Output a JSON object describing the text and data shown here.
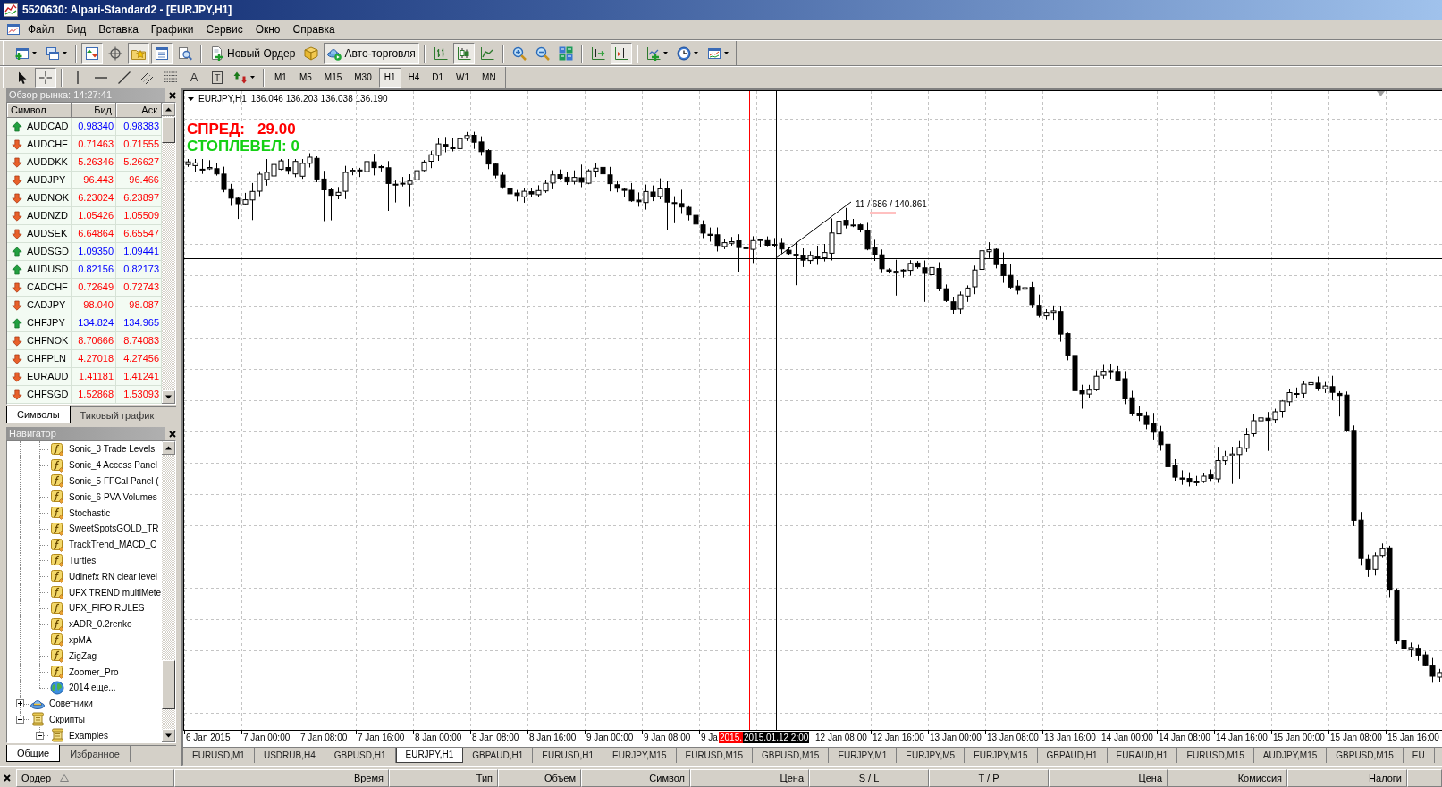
{
  "window": {
    "title": "5520630: Alpari-Standard2 - [EURJPY,H1]"
  },
  "menu": [
    "Файл",
    "Вид",
    "Вставка",
    "Графики",
    "Сервис",
    "Окно",
    "Справка"
  ],
  "toolbar": {
    "groups": [
      {
        "items": [
          {
            "kind": "new-chart",
            "pressed": false,
            "dropdown": true
          },
          {
            "kind": "profiles",
            "pressed": false,
            "dropdown": true
          }
        ]
      },
      {
        "items": [
          {
            "kind": "market-watch",
            "pressed": true,
            "dropdown": false
          },
          {
            "kind": "data-window",
            "pressed": false,
            "dropdown": false
          },
          {
            "kind": "navigator",
            "pressed": true,
            "dropdown": false
          },
          {
            "kind": "terminal",
            "pressed": true,
            "dropdown": false
          },
          {
            "kind": "tester",
            "pressed": false,
            "dropdown": false
          }
        ]
      },
      {
        "items": [
          {
            "kind": "new-order",
            "label": "Новый Ордер",
            "pressed": false,
            "dropdown": false
          },
          {
            "kind": "editor",
            "pressed": false,
            "dropdown": false
          },
          {
            "kind": "auto-trading",
            "label": "Авто-торговля",
            "pressed": true,
            "dropdown": false
          }
        ]
      },
      {
        "items": [
          {
            "kind": "bar-chart",
            "pressed": false,
            "dropdown": false
          },
          {
            "kind": "candle-chart",
            "pressed": true,
            "dropdown": false
          },
          {
            "kind": "line-chart",
            "pressed": false,
            "dropdown": false
          }
        ]
      },
      {
        "items": [
          {
            "kind": "zoom-in",
            "pressed": false,
            "dropdown": false
          },
          {
            "kind": "zoom-out",
            "pressed": false,
            "dropdown": false
          },
          {
            "kind": "tile",
            "pressed": false,
            "dropdown": false
          }
        ]
      },
      {
        "items": [
          {
            "kind": "autoscroll",
            "pressed": false,
            "dropdown": false
          },
          {
            "kind": "chart-shift",
            "pressed": true,
            "dropdown": false
          }
        ]
      },
      {
        "items": [
          {
            "kind": "indicators",
            "pressed": false,
            "dropdown": true
          },
          {
            "kind": "periods",
            "pressed": false,
            "dropdown": true
          },
          {
            "kind": "templates",
            "pressed": false,
            "dropdown": true
          }
        ]
      }
    ]
  },
  "drawing_toolbar": {
    "groups": [
      {
        "items": [
          {
            "kind": "cursor",
            "selected": false,
            "dropdown": false
          },
          {
            "kind": "crosshair",
            "selected": true,
            "dropdown": false
          }
        ]
      },
      {
        "items": [
          {
            "kind": "vertical-line",
            "selected": false,
            "dropdown": false
          },
          {
            "kind": "horizontal-line",
            "selected": false,
            "dropdown": false
          },
          {
            "kind": "trendline",
            "selected": false,
            "dropdown": false
          },
          {
            "kind": "channel",
            "selected": false,
            "dropdown": false
          },
          {
            "kind": "fibonacci",
            "selected": false,
            "dropdown": false
          },
          {
            "kind": "text",
            "glyph": "A",
            "selected": false,
            "dropdown": false
          },
          {
            "kind": "text-label",
            "glyph": "T",
            "selected": false,
            "dropdown": false
          },
          {
            "kind": "arrows",
            "selected": false,
            "dropdown": true
          }
        ]
      }
    ],
    "periods": [
      {
        "label": "M1",
        "selected": false
      },
      {
        "label": "M5",
        "selected": false
      },
      {
        "label": "M15",
        "selected": false
      },
      {
        "label": "M30",
        "selected": false
      },
      {
        "label": "H1",
        "selected": true
      },
      {
        "label": "H4",
        "selected": false
      },
      {
        "label": "D1",
        "selected": false
      },
      {
        "label": "W1",
        "selected": false
      },
      {
        "label": "MN",
        "selected": false
      }
    ]
  },
  "market_watch": {
    "title": "Обзор рынка: 14:27:41",
    "columns": [
      "Символ",
      "Бид",
      "Аск"
    ],
    "rows": [
      {
        "symbol": "AUDCAD",
        "rising": true,
        "bid": "0.98340",
        "ask": "0.98383"
      },
      {
        "symbol": "AUDCHF",
        "rising": false,
        "bid": "0.71463",
        "ask": "0.71555"
      },
      {
        "symbol": "AUDDKK",
        "rising": false,
        "bid": "5.26346",
        "ask": "5.26627"
      },
      {
        "symbol": "AUDJPY",
        "rising": false,
        "bid": "96.443",
        "ask": "96.466"
      },
      {
        "symbol": "AUDNOK",
        "rising": false,
        "bid": "6.23024",
        "ask": "6.23897"
      },
      {
        "symbol": "AUDNZD",
        "rising": false,
        "bid": "1.05426",
        "ask": "1.05509"
      },
      {
        "symbol": "AUDSEK",
        "rising": false,
        "bid": "6.64864",
        "ask": "6.65547"
      },
      {
        "symbol": "AUDSGD",
        "rising": true,
        "bid": "1.09350",
        "ask": "1.09441"
      },
      {
        "symbol": "AUDUSD",
        "rising": true,
        "bid": "0.82156",
        "ask": "0.82173"
      },
      {
        "symbol": "CADCHF",
        "rising": false,
        "bid": "0.72649",
        "ask": "0.72743"
      },
      {
        "symbol": "CADJPY",
        "rising": false,
        "bid": "98.040",
        "ask": "98.087"
      },
      {
        "symbol": "CHFJPY",
        "rising": true,
        "bid": "134.824",
        "ask": "134.965"
      },
      {
        "symbol": "CHFNOK",
        "rising": false,
        "bid": "8.70666",
        "ask": "8.74083"
      },
      {
        "symbol": "CHFPLN",
        "rising": false,
        "bid": "4.27018",
        "ask": "4.27456"
      },
      {
        "symbol": "EURAUD",
        "rising": false,
        "bid": "1.41181",
        "ask": "1.41241"
      },
      {
        "symbol": "CHFSGD",
        "rising": false,
        "bid": "1.52868",
        "ask": "1.53093"
      }
    ],
    "tabs": [
      {
        "label": "Символы",
        "selected": true
      },
      {
        "label": "Тиковый график",
        "selected": false
      }
    ]
  },
  "navigator": {
    "title": "Навигатор",
    "tree": [
      {
        "children": [
          {
            "label": "Sonic_3 Trade Levels",
            "kind": "indicator"
          },
          {
            "label": "Sonic_4 Access Panel",
            "kind": "indicator"
          },
          {
            "label": "Sonic_5 FFCal Panel (",
            "kind": "indicator"
          },
          {
            "label": "Sonic_6 PVA Volumes",
            "kind": "indicator"
          },
          {
            "label": "Stochastic",
            "kind": "indicator"
          },
          {
            "label": "SweetSpotsGOLD_TR",
            "kind": "indicator"
          },
          {
            "label": "TrackTrend_MACD_C",
            "kind": "indicator"
          },
          {
            "label": "Turtles",
            "kind": "indicator"
          },
          {
            "label": "Udinefx RN clear level",
            "kind": "indicator"
          },
          {
            "label": "UFX TREND multiMete",
            "kind": "indicator"
          },
          {
            "label": "UFX_FIFO RULES",
            "kind": "indicator"
          },
          {
            "label": "xADR_0.2renko",
            "kind": "indicator"
          },
          {
            "label": "xpMA",
            "kind": "indicator"
          },
          {
            "label": "ZigZag",
            "kind": "indicator"
          },
          {
            "label": "Zoomer_Pro",
            "kind": "indicator"
          },
          {
            "label": "2014 еще...",
            "kind": "link"
          }
        ]
      },
      {
        "label": "Советники",
        "kind": "experts",
        "expanded": false
      },
      {
        "label": "Скрипты",
        "kind": "scripts",
        "expanded": true,
        "children": [
          {
            "label": "Examples",
            "kind": "scripts",
            "expanded": true
          }
        ]
      }
    ],
    "tabs": [
      {
        "label": "Общие",
        "selected": true
      },
      {
        "label": "Избранное",
        "selected": false
      }
    ]
  },
  "chart": {
    "symbol": "EURJPY,H1",
    "ohlc": "136.046 136.203 136.038 136.190",
    "spread": "СПРЕД:   29.00",
    "stoplevel": "СТОПЛЕВЕЛ: 0",
    "trendline_label": "11 / 686 / 140.861",
    "time_labels": [
      {
        "text": "6 Jan 2015",
        "kind": "tick"
      },
      {
        "text": "7 Jan 00:00",
        "kind": "tick"
      },
      {
        "text": "7 Jan 08:00",
        "kind": "tick"
      },
      {
        "text": "7 Jan 16:00",
        "kind": "tick"
      },
      {
        "text": "8 Jan 00:00",
        "kind": "tick"
      },
      {
        "text": "8 Jan 08:00",
        "kind": "tick"
      },
      {
        "text": "8 Jan 16:00",
        "kind": "tick"
      },
      {
        "text": "9 Jan 00:00",
        "kind": "tick"
      },
      {
        "text": "9 Jan 08:00",
        "kind": "tick"
      },
      {
        "text": "9 Ja",
        "kind": "tick"
      },
      {
        "text": "2015.",
        "kind": "line-label"
      },
      {
        "text": "2015.01.12 2:00",
        "kind": "cursor-label"
      },
      {
        "text": "12 Jan 08:00",
        "kind": "tick"
      },
      {
        "text": "12 Jan 16:00",
        "kind": "tick"
      },
      {
        "text": "13 Jan 00:00",
        "kind": "tick"
      },
      {
        "text": "13 Jan 08:00",
        "kind": "tick"
      },
      {
        "text": "13 Jan 16:00",
        "kind": "tick"
      },
      {
        "text": "14 Jan 00:00",
        "kind": "tick"
      },
      {
        "text": "14 Jan 08:00",
        "kind": "tick"
      },
      {
        "text": "14 Jan 16:00",
        "kind": "tick"
      },
      {
        "text": "15 Jan 00:00",
        "kind": "tick"
      },
      {
        "text": "15 Jan 08:00",
        "kind": "tick"
      },
      {
        "text": "15 Jan 16:00",
        "kind": "tick"
      }
    ],
    "tabs": [
      {
        "label": "EURUSD,M1",
        "selected": false
      },
      {
        "label": "USDRUB,H4",
        "selected": false
      },
      {
        "label": "GBPUSD,H1",
        "selected": false
      },
      {
        "label": "EURJPY,H1",
        "selected": true
      },
      {
        "label": "GBPAUD,H1",
        "selected": false
      },
      {
        "label": "EURUSD,H1",
        "selected": false
      },
      {
        "label": "EURJPY,M15",
        "selected": false
      },
      {
        "label": "EURUSD,M15",
        "selected": false
      },
      {
        "label": "GBPUSD,M15",
        "selected": false
      },
      {
        "label": "EURJPY,M1",
        "selected": false
      },
      {
        "label": "EURJPY,M5",
        "selected": false
      },
      {
        "label": "EURJPY,M15",
        "selected": false
      },
      {
        "label": "GBPAUD,H1",
        "selected": false
      },
      {
        "label": "EURAUD,H1",
        "selected": false
      },
      {
        "label": "EURUSD,M15",
        "selected": false
      },
      {
        "label": "AUDJPY,M15",
        "selected": false
      },
      {
        "label": "GBPUSD,M15",
        "selected": false
      },
      {
        "label": "EU",
        "selected": false
      }
    ]
  },
  "terminal": {
    "columns": [
      {
        "label": "Ордер",
        "sorted": true
      },
      {
        "label": "Время",
        "sorted": false
      },
      {
        "label": "Тип",
        "sorted": false
      },
      {
        "label": "Объем",
        "sorted": false
      },
      {
        "label": "Символ",
        "sorted": false
      },
      {
        "label": "Цена",
        "sorted": false
      },
      {
        "label": "S / L",
        "sorted": false
      },
      {
        "label": "T / P",
        "sorted": false
      },
      {
        "label": "Цена",
        "sorted": false
      },
      {
        "label": "Комиссия",
        "sorted": false
      },
      {
        "label": "Налоги",
        "sorted": false
      }
    ]
  }
}
